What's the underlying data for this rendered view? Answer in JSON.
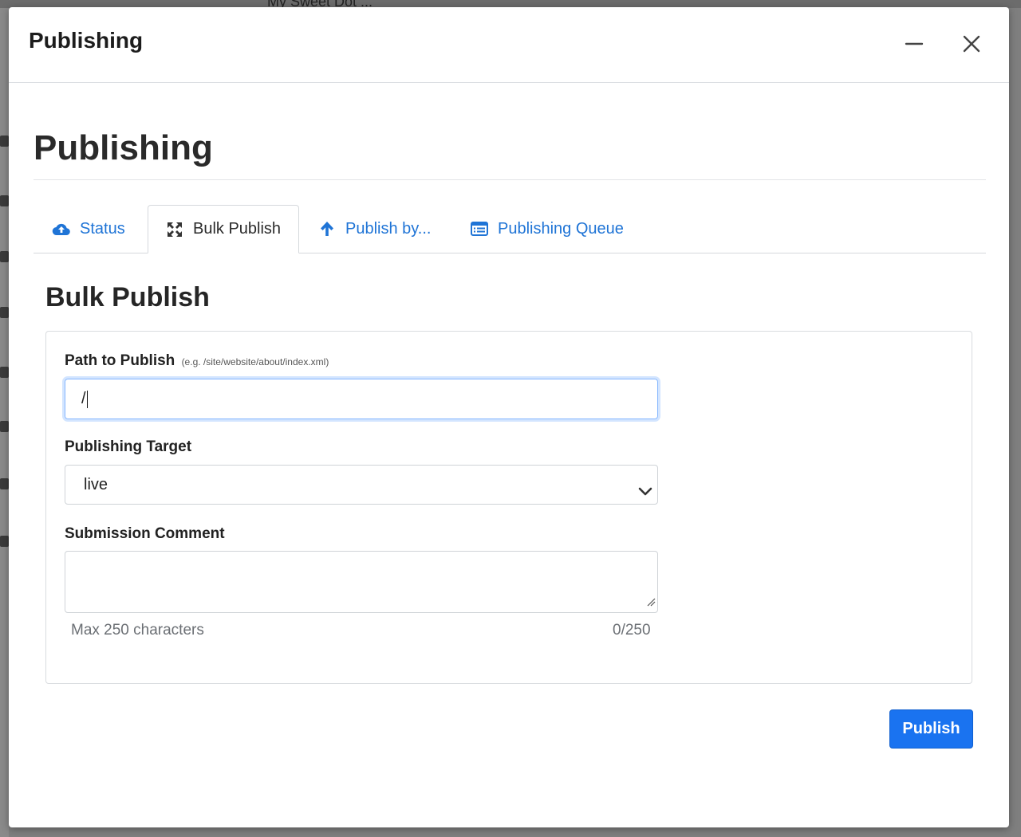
{
  "backdrop": {
    "window_label": "My Sweet Dot ..."
  },
  "dialog": {
    "title": "Publishing",
    "minimize_icon": "minimize-icon",
    "close_icon": "close-icon"
  },
  "page": {
    "heading": "Publishing",
    "tabs": [
      {
        "label": "Status",
        "icon": "cloud-upload-icon",
        "active": false
      },
      {
        "label": "Bulk Publish",
        "icon": "arrows-expand-icon",
        "active": true
      },
      {
        "label": "Publish by...",
        "icon": "arrow-up-icon",
        "active": false
      },
      {
        "label": "Publishing Queue",
        "icon": "list-window-icon",
        "active": false
      }
    ]
  },
  "form": {
    "section_title": "Bulk Publish",
    "path": {
      "label": "Path to Publish",
      "hint": "(e.g. /site/website/about/index.xml)",
      "value": "/"
    },
    "target": {
      "label": "Publishing Target",
      "selected": "live"
    },
    "comment": {
      "label": "Submission Comment",
      "value": "",
      "help": "Max 250 characters",
      "counter": "0/250"
    },
    "submit_label": "Publish"
  },
  "colors": {
    "accent": "#1a73f0",
    "link": "#1f74d6",
    "focus_border": "#86b7fe"
  }
}
